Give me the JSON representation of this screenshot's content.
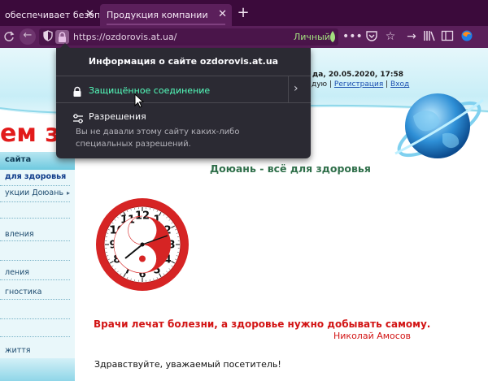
{
  "browser": {
    "tabs": [
      {
        "label": "обеспечивает безопасно",
        "active": false
      },
      {
        "label": "Продукция компании Доюань КНР",
        "active": true
      }
    ],
    "url": "https://ozdorovis.at.ua/",
    "private_label": "Личный"
  },
  "site_info": {
    "title": "Информация о сайте ozdorovis.at.ua",
    "secure_label": "Защищённое соединение",
    "permissions_title": "Разрешения",
    "permissions_desc": "Вы не давали этому сайту каких-либо специальных разрешений."
  },
  "page": {
    "header_title": "ем зд",
    "dateline": "да, 20.05.2020, 17:58",
    "userlinks": {
      "group": "дую",
      "register": "Регистрация",
      "login": "Вход"
    },
    "sidebar": {
      "heading": "сайта",
      "items": [
        {
          "label": "для здоровья",
          "bold": true,
          "arrow": false
        },
        {
          "label": "укции Доюань",
          "bold": false,
          "arrow": true
        },
        {
          "label": "",
          "bold": false,
          "arrow": false
        },
        {
          "label": "вления",
          "bold": false,
          "arrow": true
        },
        {
          "label": "",
          "bold": false,
          "arrow": false
        },
        {
          "label": "ления",
          "bold": false,
          "arrow": false
        },
        {
          "label": "гностика",
          "bold": false,
          "arrow": false
        },
        {
          "label": "",
          "bold": false,
          "arrow": false
        },
        {
          "label": "",
          "bold": false,
          "arrow": false
        },
        {
          "label": "життя",
          "bold": false,
          "arrow": false
        }
      ]
    },
    "subtitle": "Доюань - всё для здоровья",
    "clock": {
      "numbers": [
        "12",
        "1",
        "2",
        "3",
        "4",
        "5",
        "6",
        "7",
        "8",
        "9",
        "10",
        "11"
      ],
      "rim_color": "#d62424"
    },
    "quote": "Врачи лечат болезни, а здоровье нужно добывать самому.",
    "quote_author": "Николай Амосов",
    "greeting": "Здравствуйте, уважаемый посетитель!"
  },
  "colors": {
    "tabstrip": "#3b0a3b",
    "navbar": "#5a1f5a",
    "popup": "#2b2a33",
    "secure_green": "#54ffbd",
    "accent_red": "#d21414"
  }
}
